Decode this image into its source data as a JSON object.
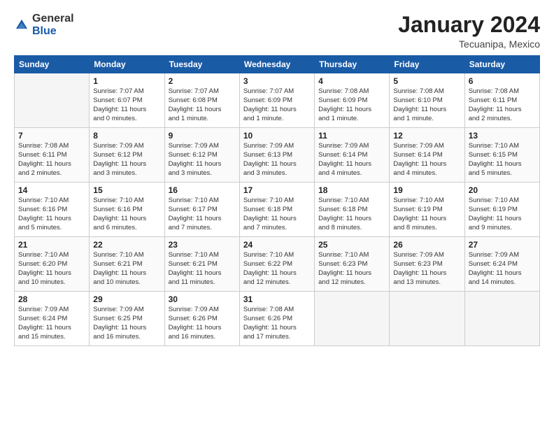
{
  "logo": {
    "general": "General",
    "blue": "Blue"
  },
  "title": "January 2024",
  "subtitle": "Tecuanipa, Mexico",
  "days_of_week": [
    "Sunday",
    "Monday",
    "Tuesday",
    "Wednesday",
    "Thursday",
    "Friday",
    "Saturday"
  ],
  "weeks": [
    [
      {
        "day": "",
        "info": ""
      },
      {
        "day": "1",
        "info": "Sunrise: 7:07 AM\nSunset: 6:07 PM\nDaylight: 11 hours\nand 0 minutes."
      },
      {
        "day": "2",
        "info": "Sunrise: 7:07 AM\nSunset: 6:08 PM\nDaylight: 11 hours\nand 1 minute."
      },
      {
        "day": "3",
        "info": "Sunrise: 7:07 AM\nSunset: 6:09 PM\nDaylight: 11 hours\nand 1 minute."
      },
      {
        "day": "4",
        "info": "Sunrise: 7:08 AM\nSunset: 6:09 PM\nDaylight: 11 hours\nand 1 minute."
      },
      {
        "day": "5",
        "info": "Sunrise: 7:08 AM\nSunset: 6:10 PM\nDaylight: 11 hours\nand 1 minute."
      },
      {
        "day": "6",
        "info": "Sunrise: 7:08 AM\nSunset: 6:11 PM\nDaylight: 11 hours\nand 2 minutes."
      }
    ],
    [
      {
        "day": "7",
        "info": "Sunrise: 7:08 AM\nSunset: 6:11 PM\nDaylight: 11 hours\nand 2 minutes."
      },
      {
        "day": "8",
        "info": "Sunrise: 7:09 AM\nSunset: 6:12 PM\nDaylight: 11 hours\nand 3 minutes."
      },
      {
        "day": "9",
        "info": "Sunrise: 7:09 AM\nSunset: 6:12 PM\nDaylight: 11 hours\nand 3 minutes."
      },
      {
        "day": "10",
        "info": "Sunrise: 7:09 AM\nSunset: 6:13 PM\nDaylight: 11 hours\nand 3 minutes."
      },
      {
        "day": "11",
        "info": "Sunrise: 7:09 AM\nSunset: 6:14 PM\nDaylight: 11 hours\nand 4 minutes."
      },
      {
        "day": "12",
        "info": "Sunrise: 7:09 AM\nSunset: 6:14 PM\nDaylight: 11 hours\nand 4 minutes."
      },
      {
        "day": "13",
        "info": "Sunrise: 7:10 AM\nSunset: 6:15 PM\nDaylight: 11 hours\nand 5 minutes."
      }
    ],
    [
      {
        "day": "14",
        "info": "Sunrise: 7:10 AM\nSunset: 6:16 PM\nDaylight: 11 hours\nand 5 minutes."
      },
      {
        "day": "15",
        "info": "Sunrise: 7:10 AM\nSunset: 6:16 PM\nDaylight: 11 hours\nand 6 minutes."
      },
      {
        "day": "16",
        "info": "Sunrise: 7:10 AM\nSunset: 6:17 PM\nDaylight: 11 hours\nand 7 minutes."
      },
      {
        "day": "17",
        "info": "Sunrise: 7:10 AM\nSunset: 6:18 PM\nDaylight: 11 hours\nand 7 minutes."
      },
      {
        "day": "18",
        "info": "Sunrise: 7:10 AM\nSunset: 6:18 PM\nDaylight: 11 hours\nand 8 minutes."
      },
      {
        "day": "19",
        "info": "Sunrise: 7:10 AM\nSunset: 6:19 PM\nDaylight: 11 hours\nand 8 minutes."
      },
      {
        "day": "20",
        "info": "Sunrise: 7:10 AM\nSunset: 6:19 PM\nDaylight: 11 hours\nand 9 minutes."
      }
    ],
    [
      {
        "day": "21",
        "info": "Sunrise: 7:10 AM\nSunset: 6:20 PM\nDaylight: 11 hours\nand 10 minutes."
      },
      {
        "day": "22",
        "info": "Sunrise: 7:10 AM\nSunset: 6:21 PM\nDaylight: 11 hours\nand 10 minutes."
      },
      {
        "day": "23",
        "info": "Sunrise: 7:10 AM\nSunset: 6:21 PM\nDaylight: 11 hours\nand 11 minutes."
      },
      {
        "day": "24",
        "info": "Sunrise: 7:10 AM\nSunset: 6:22 PM\nDaylight: 11 hours\nand 12 minutes."
      },
      {
        "day": "25",
        "info": "Sunrise: 7:10 AM\nSunset: 6:23 PM\nDaylight: 11 hours\nand 12 minutes."
      },
      {
        "day": "26",
        "info": "Sunrise: 7:09 AM\nSunset: 6:23 PM\nDaylight: 11 hours\nand 13 minutes."
      },
      {
        "day": "27",
        "info": "Sunrise: 7:09 AM\nSunset: 6:24 PM\nDaylight: 11 hours\nand 14 minutes."
      }
    ],
    [
      {
        "day": "28",
        "info": "Sunrise: 7:09 AM\nSunset: 6:24 PM\nDaylight: 11 hours\nand 15 minutes."
      },
      {
        "day": "29",
        "info": "Sunrise: 7:09 AM\nSunset: 6:25 PM\nDaylight: 11 hours\nand 16 minutes."
      },
      {
        "day": "30",
        "info": "Sunrise: 7:09 AM\nSunset: 6:26 PM\nDaylight: 11 hours\nand 16 minutes."
      },
      {
        "day": "31",
        "info": "Sunrise: 7:08 AM\nSunset: 6:26 PM\nDaylight: 11 hours\nand 17 minutes."
      },
      {
        "day": "",
        "info": ""
      },
      {
        "day": "",
        "info": ""
      },
      {
        "day": "",
        "info": ""
      }
    ]
  ]
}
